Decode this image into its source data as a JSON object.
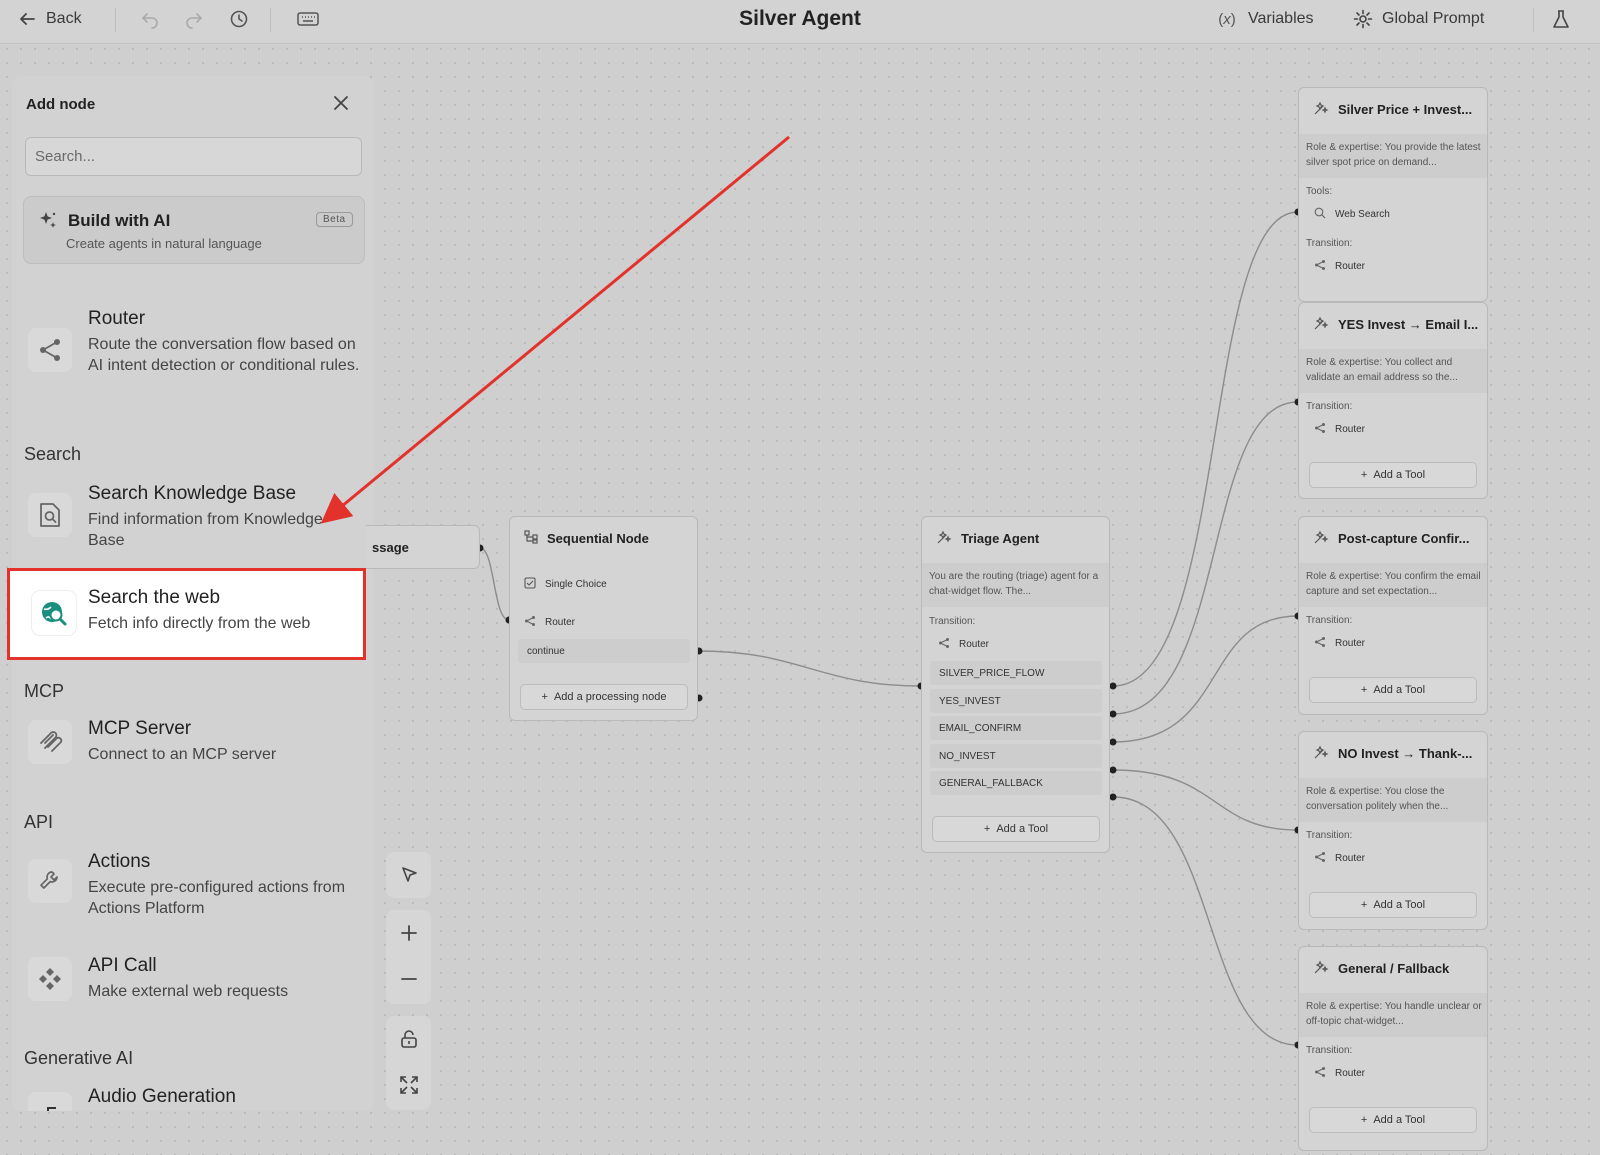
{
  "topbar": {
    "back_label": "Back",
    "title": "Silver Agent",
    "variables_label": "Variables",
    "global_prompt_label": "Global Prompt"
  },
  "panel": {
    "title": "Add node",
    "search_placeholder": "Search...",
    "build_ai": {
      "title": "Build with AI",
      "subtitle": "Create agents in natural language",
      "badge": "Beta"
    },
    "router": {
      "title": "Router",
      "desc": "Route the conversation flow based on AI intent detection or conditional rules."
    },
    "sections": {
      "search": "Search",
      "mcp": "MCP",
      "api": "API",
      "genai": "Generative AI"
    },
    "search_kb": {
      "title": "Search Knowledge Base",
      "desc": "Find information from Knowledge Base"
    },
    "search_web": {
      "title": "Search the web",
      "desc": "Fetch info directly from the web"
    },
    "mcp_server": {
      "title": "MCP Server",
      "desc": "Connect to an MCP server"
    },
    "actions": {
      "title": "Actions",
      "desc": "Execute pre-configured actions from Actions Platform"
    },
    "api_call": {
      "title": "API Call",
      "desc": "Make external web requests"
    },
    "audio_gen": {
      "title": "Audio Generation"
    }
  },
  "canvas": {
    "message_node_label": "ssage",
    "sequential": {
      "title": "Sequential Node",
      "single_choice": "Single Choice",
      "router": "Router",
      "continue": "continue",
      "add_label": "Add a processing node"
    },
    "triage": {
      "title": "Triage Agent",
      "desc": "You are the routing (triage) agent for a chat-widget flow. The...",
      "transition_label": "Transition:",
      "router": "Router",
      "routes": [
        "SILVER_PRICE_FLOW",
        "YES_INVEST",
        "EMAIL_CONFIRM",
        "NO_INVEST",
        "GENERAL_FALLBACK"
      ],
      "add_tool": "Add a Tool"
    },
    "agents": [
      {
        "title": "Silver Price + Invest...",
        "desc": "Role & expertise: You provide the latest silver spot price on demand...",
        "tools_label": "Tools:",
        "tool": "Web Search",
        "transition_label": "Transition:",
        "router": "Router"
      },
      {
        "title": "YES Invest → Email I...",
        "desc": "Role & expertise: You collect and validate an email address so the...",
        "transition_label": "Transition:",
        "router": "Router",
        "add_tool": "Add a Tool"
      },
      {
        "title": "Post-capture Confir...",
        "desc": "Role & expertise: You confirm the email capture and set expectation...",
        "transition_label": "Transition:",
        "router": "Router",
        "add_tool": "Add a Tool"
      },
      {
        "title": "NO Invest → Thank-...",
        "desc": "Role & expertise: You close the conversation politely when the...",
        "transition_label": "Transition:",
        "router": "Router",
        "add_tool": "Add a Tool"
      },
      {
        "title": "General / Fallback",
        "desc": "Role & expertise: You handle unclear or off-topic chat-widget...",
        "transition_label": "Transition:",
        "router": "Router",
        "add_tool": "Add a Tool"
      }
    ]
  },
  "colors": {
    "highlight": "#e2322b",
    "arrow": "#e2322b",
    "web_icon": "#1a8f7d"
  }
}
